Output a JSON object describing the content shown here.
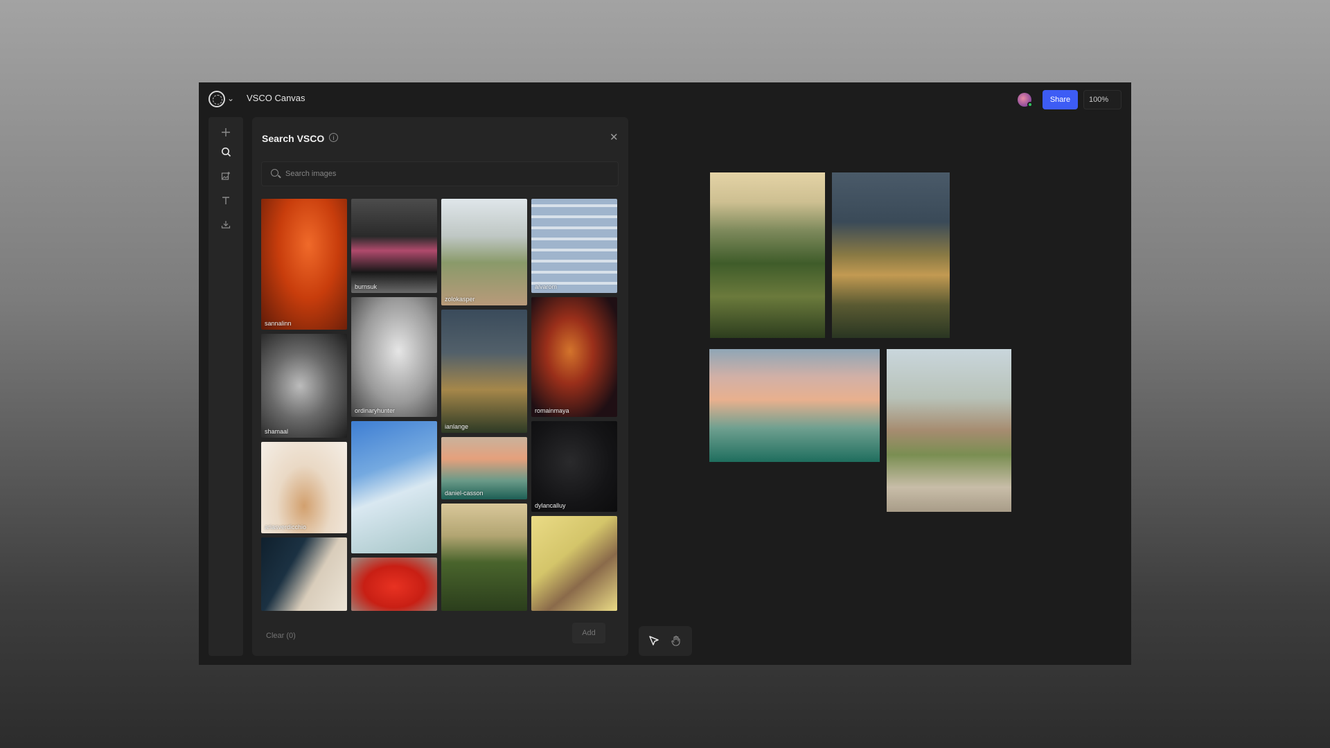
{
  "app": {
    "title": "VSCO Canvas",
    "share_label": "Share",
    "zoom": "100%",
    "brand_color": "#3d5cf5"
  },
  "toolbar": {
    "tools": [
      "plus-icon",
      "search-icon",
      "image-add-icon",
      "text-icon",
      "download-icon"
    ]
  },
  "panel": {
    "title": "Search VSCO",
    "search_placeholder": "Search images",
    "clear_label": "Clear (0)",
    "add_label": "Add",
    "results": [
      {
        "user": "sannalinn"
      },
      {
        "user": "shamaal"
      },
      {
        "user": "ariasverdicchio"
      },
      {
        "user": ""
      },
      {
        "user": "burnsuk"
      },
      {
        "user": "ordinaryhunter"
      },
      {
        "user": ""
      },
      {
        "user": ""
      },
      {
        "user": "zolokasper"
      },
      {
        "user": "ianlange"
      },
      {
        "user": "daniel-casson"
      },
      {
        "user": ""
      },
      {
        "user": "alvarom"
      },
      {
        "user": "romainmaya"
      },
      {
        "user": "dylancalluy"
      },
      {
        "user": ""
      }
    ]
  },
  "canvas": {
    "images": [
      "coast-hills",
      "mountain-slope",
      "misty-forest",
      "rock-formations"
    ]
  },
  "bottom_tools": [
    "pointer-icon",
    "hand-icon"
  ]
}
